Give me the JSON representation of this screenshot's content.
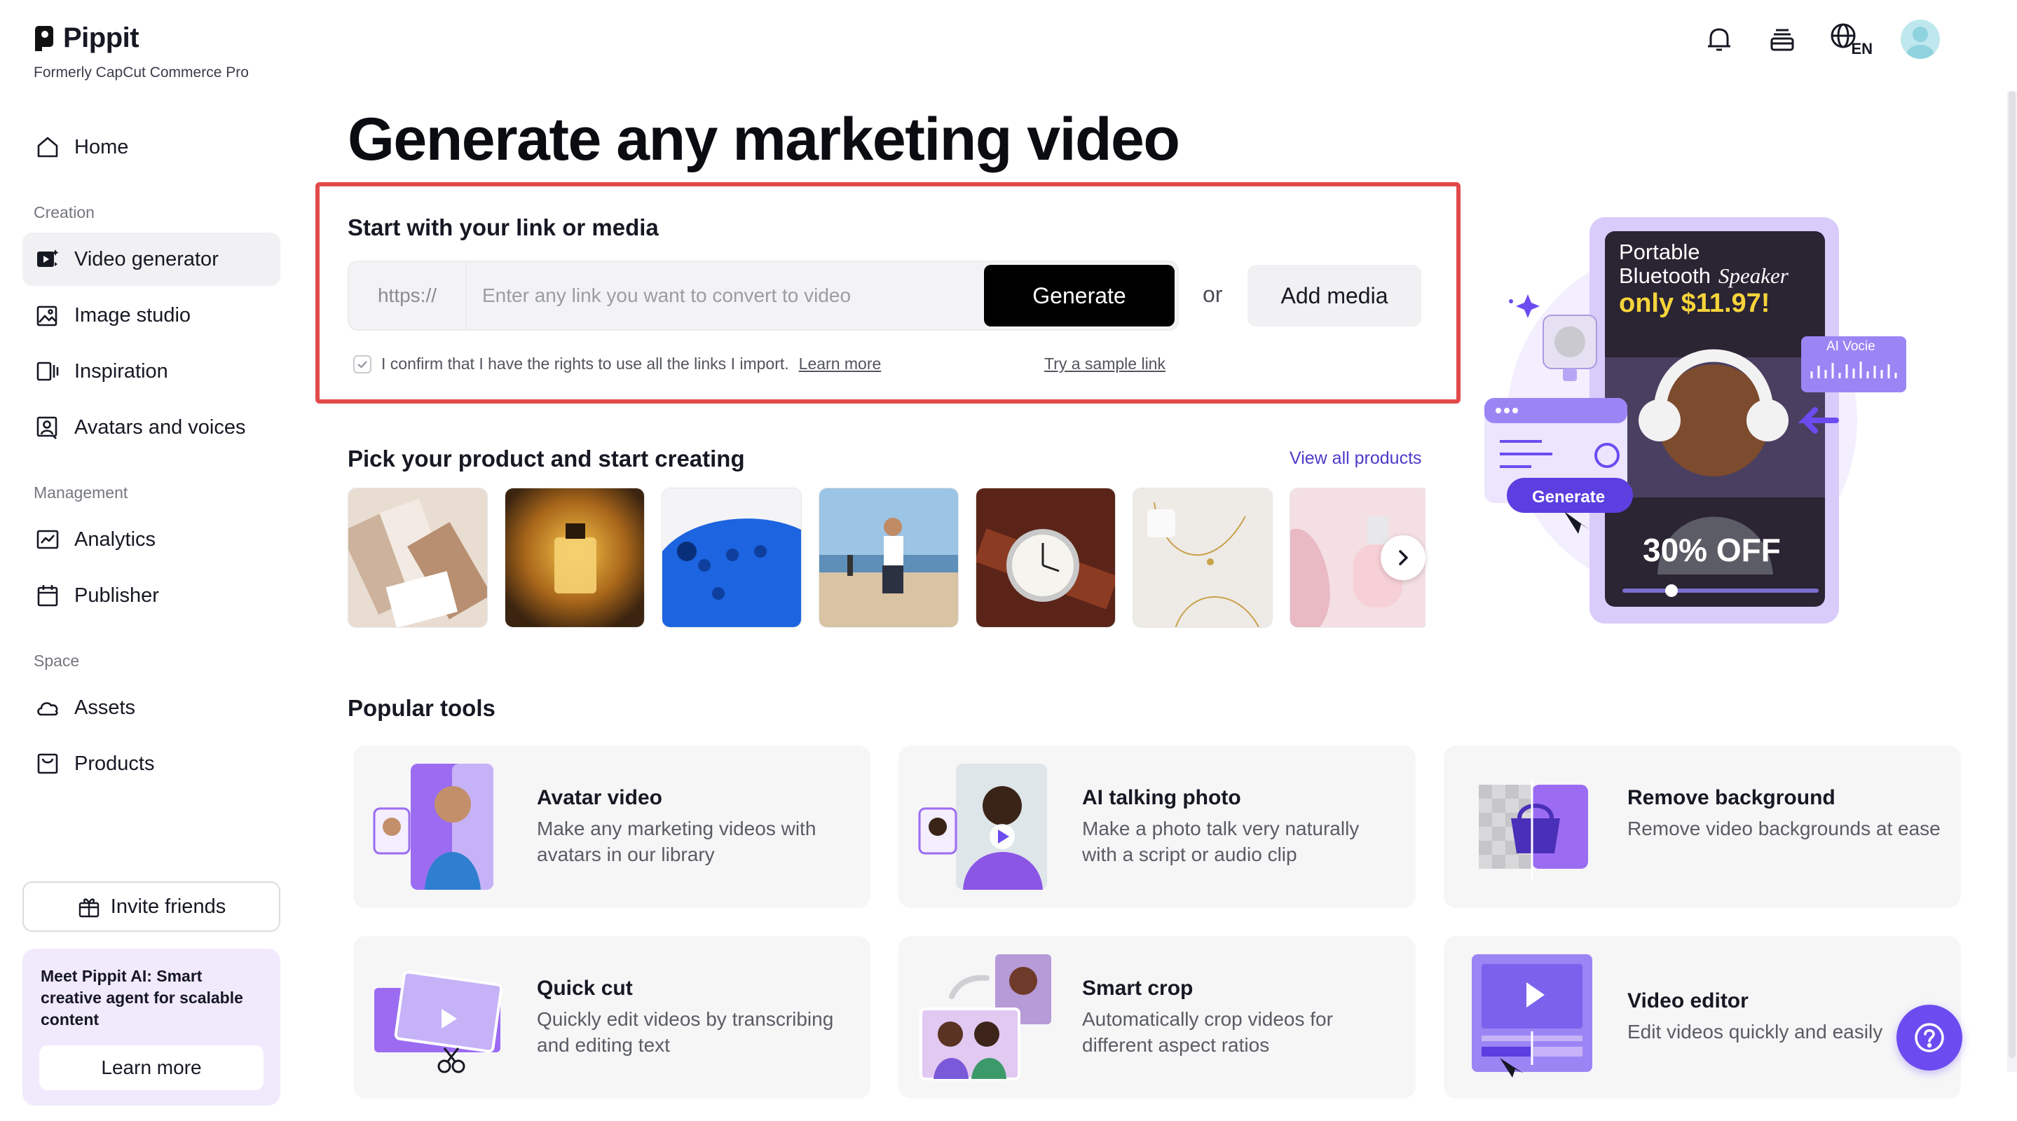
{
  "brand": {
    "name": "Pippit",
    "subtitle": "Formerly CapCut Commerce Pro"
  },
  "sidebar": {
    "home": "Home",
    "sections": {
      "creation": "Creation",
      "management": "Management",
      "space": "Space"
    },
    "items": {
      "video_generator": "Video generator",
      "image_studio": "Image studio",
      "inspiration": "Inspiration",
      "avatars_voices": "Avatars and voices",
      "analytics": "Analytics",
      "publisher": "Publisher",
      "assets": "Assets",
      "products": "Products"
    },
    "invite": "Invite friends",
    "promo": {
      "text": "Meet Pippit AI: Smart creative agent for scalable content",
      "button": "Learn more"
    }
  },
  "topbar": {
    "language": "EN"
  },
  "main": {
    "headline": "Generate any marketing video",
    "link_box": {
      "title": "Start with your link or media",
      "prefix": "https://",
      "placeholder": "Enter any link you want to convert to video",
      "generate": "Generate",
      "or": "or",
      "add_media": "Add media",
      "confirm": "I confirm that I have the rights to use all the links I import.",
      "learn_more": "Learn more",
      "sample": "Try a sample link"
    },
    "pick": {
      "title": "Pick your product and start creating",
      "view_all": "View all products"
    },
    "hero": {
      "product": "Portable",
      "product2": "Bluetooth",
      "product3": "Speaker",
      "price": "only $11.97!",
      "discount": "30% OFF",
      "ai_voice": "AI Vocie",
      "generate": "Generate"
    },
    "tools": {
      "title": "Popular tools",
      "items": [
        {
          "name": "Avatar video",
          "desc": "Make any marketing videos with avatars in our library"
        },
        {
          "name": "AI talking photo",
          "desc": "Make a photo talk very naturally with a script or audio clip"
        },
        {
          "name": "Remove background",
          "desc": "Remove video backgrounds at ease"
        },
        {
          "name": "Quick cut",
          "desc": "Quickly edit videos by transcribing and editing text"
        },
        {
          "name": "Smart crop",
          "desc": "Automatically crop videos for different aspect ratios"
        },
        {
          "name": "Video editor",
          "desc": "Edit videos quickly and easily"
        }
      ]
    }
  },
  "colors": {
    "accent": "#6c4cf0",
    "highlight_border": "#e24a4a",
    "link": "#4c3bc8",
    "promo_bg": "#f1eafd"
  }
}
